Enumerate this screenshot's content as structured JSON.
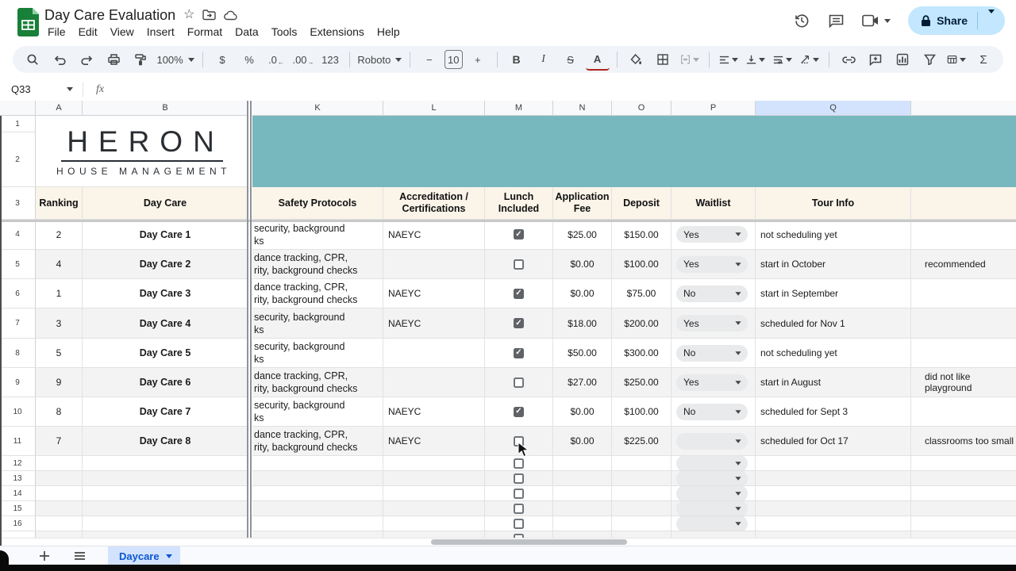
{
  "titlebar": {
    "title": "Day Care Evaluation",
    "menus": [
      "File",
      "Edit",
      "View",
      "Insert",
      "Format",
      "Data",
      "Tools",
      "Extensions",
      "Help"
    ],
    "share_label": "Share"
  },
  "toolbar": {
    "zoom": "100%",
    "currency": "$",
    "percent": "%",
    "decrease_decimal": ".0",
    "increase_decimal": ".00",
    "more_formats": "123",
    "font": "Roboto",
    "minus": "−",
    "font_size": "10",
    "plus": "+",
    "bold": "B",
    "italic": "I",
    "strikethrough": "S",
    "text_color": "A",
    "functions": "Σ"
  },
  "formula_bar": {
    "cell_ref": "Q33",
    "fx_label": "fx"
  },
  "grid": {
    "col_letters": {
      "A": "A",
      "B": "B",
      "K": "K",
      "L": "L",
      "M": "M",
      "N": "N",
      "O": "O",
      "P": "P",
      "Q": "Q",
      "R": ""
    },
    "selected_col": "Q",
    "logo": {
      "line1": "HERON",
      "line2": "HOUSE MANAGEMENT"
    },
    "header_cells": {
      "A": "Ranking",
      "B": "Day Care",
      "K": "Safety Protocols",
      "L": "Accreditation /|Certifications",
      "M": "Lunch|Included",
      "N": "Application|Fee",
      "O": "Deposit",
      "P": "Waitlist",
      "Q": "Tour Info",
      "R": ""
    },
    "rows": [
      {
        "num": "4",
        "ranking": "2",
        "name": "Day Care 1",
        "safety": [
          "security, background",
          "ks"
        ],
        "accreditation": "NAEYC",
        "lunch": true,
        "fee": "$25.00",
        "deposit": "$150.00",
        "waitlist": "Yes",
        "tour": "not scheduling yet",
        "note": ""
      },
      {
        "num": "5",
        "ranking": "4",
        "name": "Day Care 2",
        "safety": [
          "dance tracking, CPR,",
          "rity, background checks"
        ],
        "accreditation": "",
        "lunch": false,
        "fee": "$0.00",
        "deposit": "$100.00",
        "waitlist": "Yes",
        "tour": "start in October",
        "note": "recommended"
      },
      {
        "num": "6",
        "ranking": "1",
        "name": "Day Care 3",
        "safety": [
          "dance tracking, CPR,",
          "rity, background checks"
        ],
        "accreditation": "NAEYC",
        "lunch": true,
        "fee": "$0.00",
        "deposit": "$75.00",
        "waitlist": "No",
        "tour": "start in September",
        "note": ""
      },
      {
        "num": "7",
        "ranking": "3",
        "name": "Day Care 4",
        "safety": [
          "security, background",
          "ks"
        ],
        "accreditation": "NAEYC",
        "lunch": true,
        "fee": "$18.00",
        "deposit": "$200.00",
        "waitlist": "Yes",
        "tour": "scheduled for Nov 1",
        "note": ""
      },
      {
        "num": "8",
        "ranking": "5",
        "name": "Day Care 5",
        "safety": [
          "security, background",
          "ks"
        ],
        "accreditation": "",
        "lunch": true,
        "fee": "$50.00",
        "deposit": "$300.00",
        "waitlist": "No",
        "tour": "not scheduling yet",
        "note": ""
      },
      {
        "num": "9",
        "ranking": "9",
        "name": "Day Care 6",
        "safety": [
          "dance tracking, CPR,",
          "rity, background checks"
        ],
        "accreditation": "",
        "lunch": false,
        "fee": "$27.00",
        "deposit": "$250.00",
        "waitlist": "Yes",
        "tour": "start in August",
        "note": "did not like playground"
      },
      {
        "num": "10",
        "ranking": "8",
        "name": "Day Care 7",
        "safety": [
          "security, background",
          "ks"
        ],
        "accreditation": "NAEYC",
        "lunch": true,
        "fee": "$0.00",
        "deposit": "$100.00",
        "waitlist": "No",
        "tour": "scheduled for Sept 3",
        "note": ""
      },
      {
        "num": "11",
        "ranking": "7",
        "name": "Day Care 8",
        "safety": [
          "dance tracking, CPR,",
          "rity, background checks"
        ],
        "accreditation": "NAEYC",
        "lunch": false,
        "fee": "$0.00",
        "deposit": "$225.00",
        "waitlist": "",
        "tour": "scheduled for Oct 17",
        "note": "classrooms too small"
      }
    ],
    "empty_row_nums": [
      "12",
      "13",
      "14",
      "15",
      "16"
    ],
    "checkbox_glyph": "✓"
  },
  "sheetbar": {
    "active_tab": "Daycare"
  },
  "colors": {
    "teal_banner": "#77b8be",
    "header_row_bg": "#faf4e9",
    "row_alt_bg": "#f3f3f3",
    "selected_col_bg": "#d3e3fd",
    "share_btn_bg": "#c2e7ff",
    "share_btn_text": "#001d35",
    "active_tab_bg": "#d3e3fd",
    "active_tab_text": "#0b57d0",
    "toolbar_bg": "#f0f4f9",
    "checkbox_checked": "#5f6368",
    "sheets_icon_green": "#188038"
  }
}
